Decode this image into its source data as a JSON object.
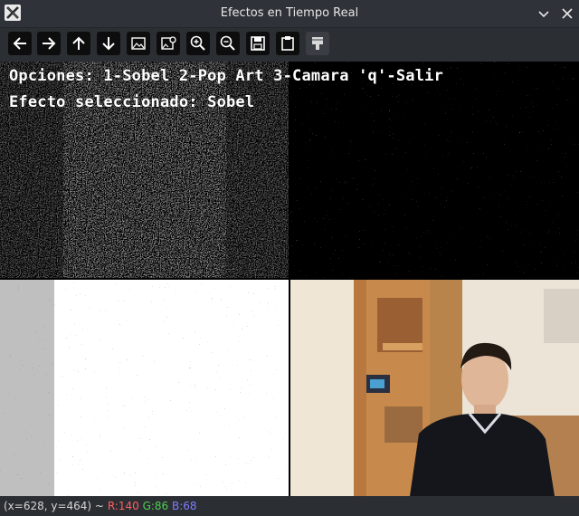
{
  "window": {
    "title": "Efectos en Tiempo Real"
  },
  "toolbar": {
    "buttons": [
      {
        "icon": "arrow-left-icon"
      },
      {
        "icon": "arrow-right-icon"
      },
      {
        "icon": "arrow-up-icon"
      },
      {
        "icon": "arrow-down-icon"
      },
      {
        "icon": "image-icon"
      },
      {
        "icon": "image-settings-icon"
      },
      {
        "icon": "zoom-in-icon"
      },
      {
        "icon": "zoom-out-icon"
      },
      {
        "icon": "save-icon"
      },
      {
        "icon": "clipboard-icon"
      },
      {
        "icon": "properties-icon"
      }
    ]
  },
  "canvas": {
    "options_text": "Opciones: 1-Sobel 2-Pop Art 3-Camara 'q'-Salir",
    "selected_text": "Efecto seleccionado: Sobel"
  },
  "status": {
    "coords": "(x=628, y=464) ~",
    "r": "R:140",
    "g": "G:86",
    "b": "B:68"
  },
  "colors": {
    "titlebar": "#2f3238",
    "toolbar": "#2b2e33",
    "r": "#ff6060",
    "g": "#4fcf4f",
    "b": "#7d7dff"
  }
}
